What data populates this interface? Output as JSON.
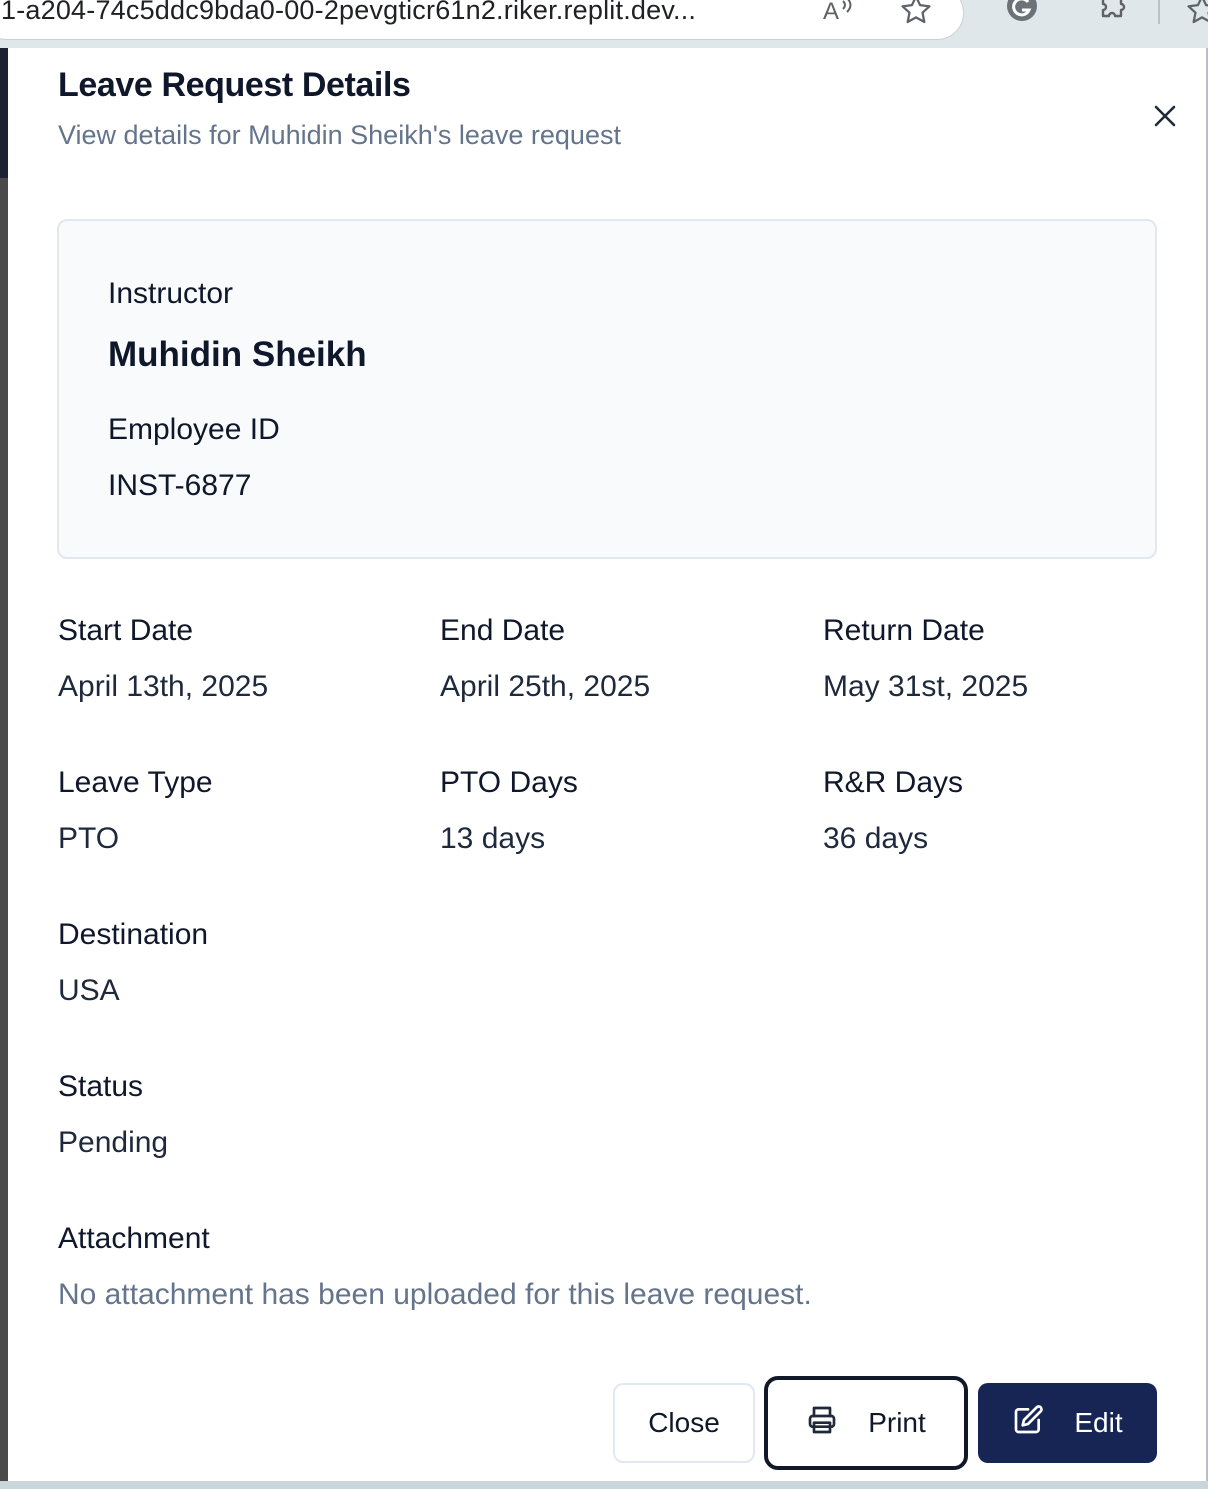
{
  "browser": {
    "url": "1-a204-74c5ddc9bda0-00-2pevgticr61n2.riker.replit.dev..."
  },
  "dialog": {
    "title": "Leave Request Details",
    "subtitle": "View details for Muhidin Sheikh's leave request",
    "instructor": {
      "label": "Instructor",
      "name": "Muhidin Sheikh",
      "employee_id_label": "Employee ID",
      "employee_id": "INST-6877"
    },
    "fields": {
      "start_date": {
        "label": "Start Date",
        "value": "April 13th, 2025"
      },
      "end_date": {
        "label": "End Date",
        "value": "April 25th, 2025"
      },
      "return_date": {
        "label": "Return Date",
        "value": "May 31st, 2025"
      },
      "leave_type": {
        "label": "Leave Type",
        "value": "PTO"
      },
      "pto_days": {
        "label": "PTO Days",
        "value": "13 days"
      },
      "rr_days": {
        "label": "R&R Days",
        "value": "36 days"
      },
      "destination": {
        "label": "Destination",
        "value": "USA"
      },
      "status": {
        "label": "Status",
        "value": "Pending"
      },
      "attachment": {
        "label": "Attachment",
        "value": "No attachment has been uploaded for this leave request."
      }
    },
    "buttons": {
      "close": "Close",
      "print": "Print",
      "edit": "Edit"
    }
  },
  "colors": {
    "primary": "#172554",
    "muted_text": "#64748b",
    "card_bg": "#f8fafc"
  }
}
